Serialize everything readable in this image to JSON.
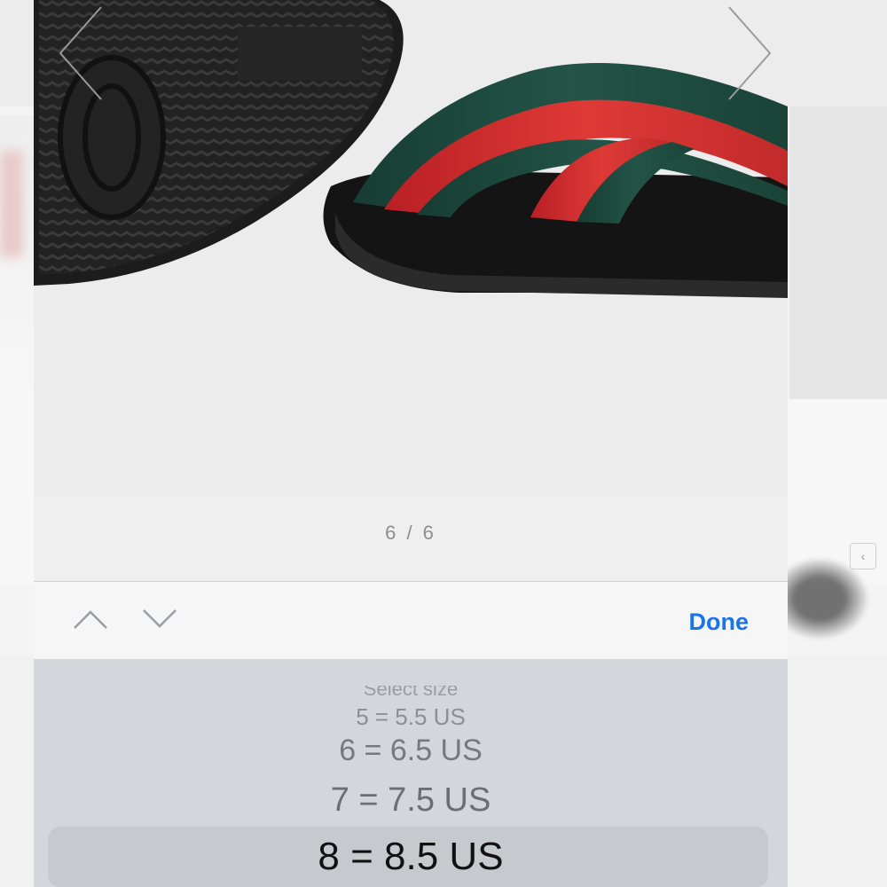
{
  "gallery": {
    "counter": "6 / 6"
  },
  "toolbar": {
    "done_label": "Done"
  },
  "picker": {
    "options": [
      "Select size",
      "5 = 5.5 US",
      "6 = 6.5 US",
      "7 = 7.5 US",
      "8 = 8.5 US"
    ],
    "selected": "8 = 8.5 US"
  },
  "colors": {
    "accent": "#1a73e8",
    "stripe_green": "#1f4a3f",
    "stripe_red": "#c9252b",
    "sole_black": "#1d1d1d"
  },
  "icons": {
    "prev_image": "chevron-left-icon",
    "next_image": "chevron-right-icon",
    "prev_field": "chevron-up-icon",
    "next_field": "chevron-down-icon"
  }
}
